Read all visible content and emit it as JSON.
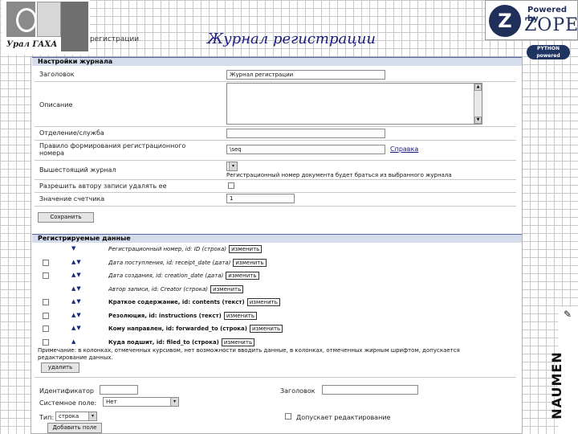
{
  "page": {
    "title": "Журнал регистрации",
    "window_caption": "регистрации"
  },
  "logo": {
    "text": "Урал ГАХА",
    "icon": "academy-logo"
  },
  "badges": {
    "zope_powered": "Powered by",
    "zope_name": "ZOPE",
    "python_line1": "PYTHON",
    "python_line2": "powered",
    "naumen": "NAUMEN"
  },
  "settings": {
    "header": "Настройки журнала",
    "title_label": "Заголовок",
    "title_value": "Журнал регистрации",
    "description_label": "Описание",
    "department_label": "Отделение/служба",
    "rule_label_1": "Правило формирования регистрационного",
    "rule_label_2": "номера",
    "rule_value": "\\seq",
    "rule_help_link": "Справка",
    "parent_label": "Вышестоящий журнал",
    "parent_note": "Регистрационный номер документа будет браться из выбранного журнала",
    "allow_delete_label": "Разрешить автору записи удалять ее",
    "counter_label": "Значение счетчика",
    "counter_value": "1",
    "save_button": "Сохранить"
  },
  "fields": {
    "header": "Регистрируемые данные",
    "change_label": "изменить",
    "rows": [
      {
        "text": "Регистрационный номер, id: ID (строка)",
        "style": "italic",
        "checkbox": false,
        "arrows": "▼"
      },
      {
        "text": "Дата поступления, id: receipt_date (дата)",
        "style": "italic",
        "checkbox": true,
        "arrows": "▲▼"
      },
      {
        "text": "Дата создания, id: creation_date (дата)",
        "style": "italic",
        "checkbox": true,
        "arrows": "▲▼"
      },
      {
        "text": "Автор записи, id: Creator (строка)",
        "style": "italic",
        "checkbox": false,
        "arrows": "▲▼"
      },
      {
        "text": "Краткое содержание, id: contents (текст)",
        "style": "bold",
        "checkbox": true,
        "arrows": "▲▼"
      },
      {
        "text": "Резолюция, id: instructions (текст)",
        "style": "bold",
        "checkbox": true,
        "arrows": "▲▼"
      },
      {
        "text": "Кому направлен, id: forwarded_to (строка)",
        "style": "bold",
        "checkbox": true,
        "arrows": "▲▼"
      },
      {
        "text": "Куда подшит, id: filed_to (строка)",
        "style": "bold",
        "checkbox": true,
        "arrows": "▲"
      }
    ],
    "note_line1": "Примечание: в колонках, отмеченных курсивом, нет возможности вводить данные, в колонках, отмеченных жирным шрифтом, допускается",
    "note_line2": "редактирование данных.",
    "delete_button": "удалить"
  },
  "add_field": {
    "id_label": "Идентификатор",
    "heading_label": "Заголовок",
    "system_field_label": "Системное поле:",
    "system_field_value": "Нет",
    "type_label": "Тип:",
    "type_value": "строка",
    "editable_label": "Допускает редактирование",
    "add_button": "Добавить поле"
  }
}
